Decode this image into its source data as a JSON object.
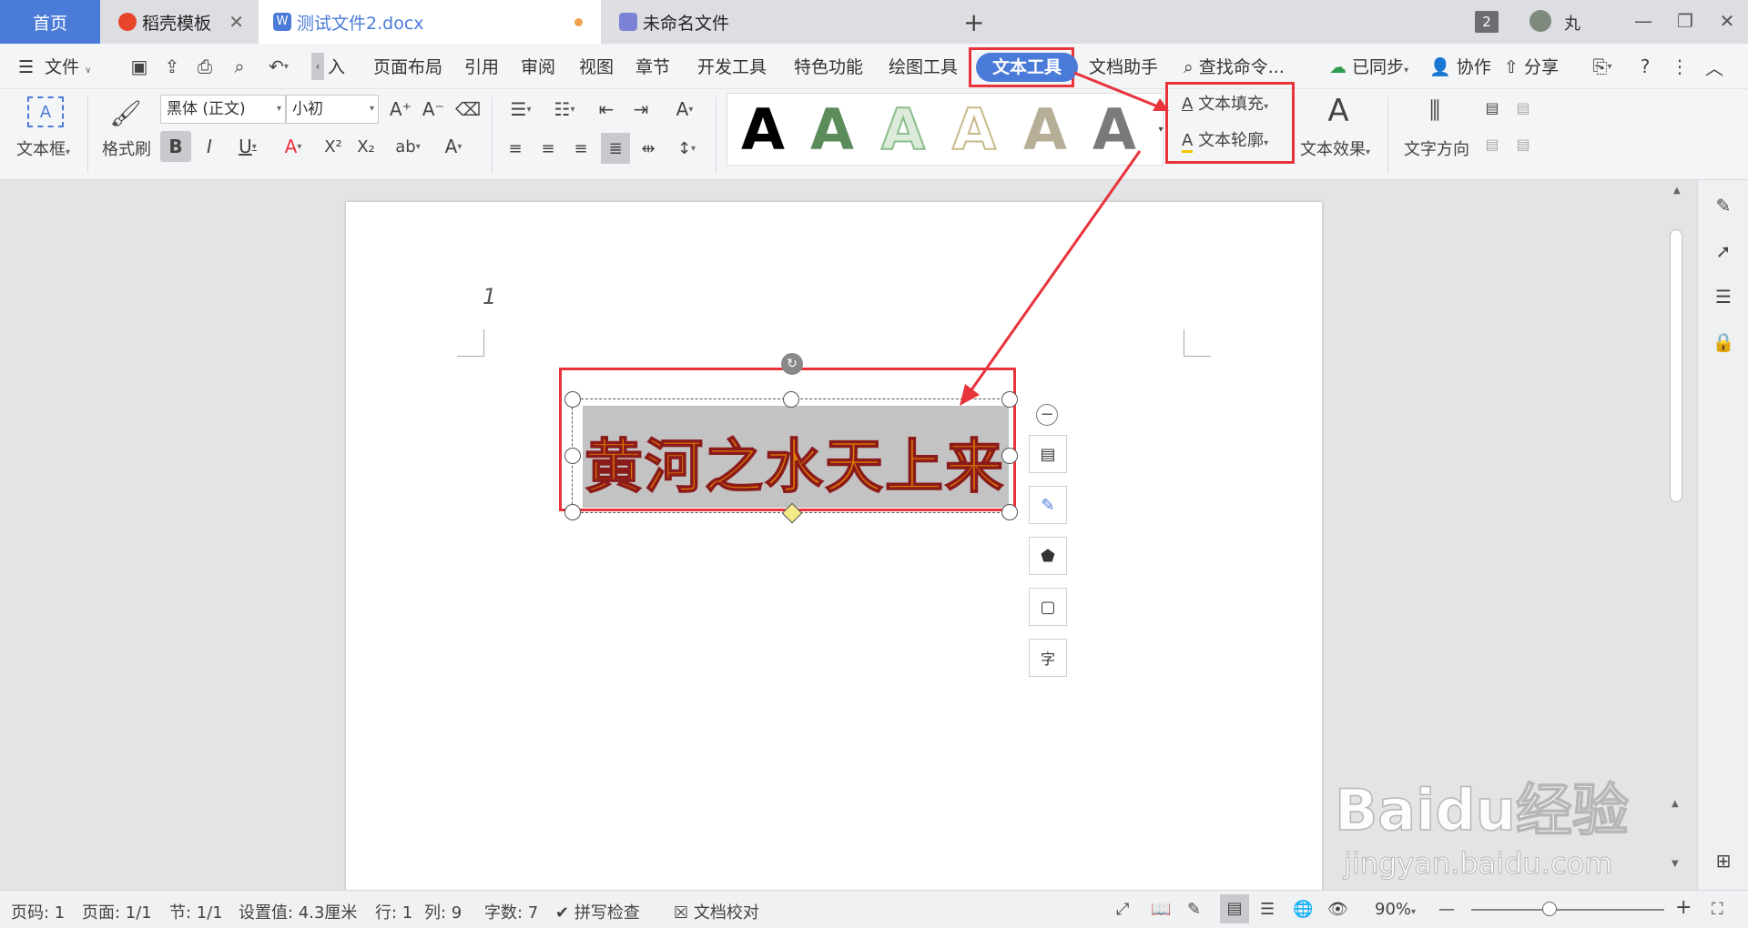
{
  "tabs": {
    "home": "首页",
    "daoke": "稻壳模板",
    "doc": "测试文件2.docx",
    "unnamed": "未命名文件",
    "new_tab": "+",
    "badge": "2",
    "user": "丸"
  },
  "menu": {
    "file": "文件",
    "insert": "入",
    "layout": "页面布局",
    "reference": "引用",
    "review": "审阅",
    "view": "视图",
    "chapter": "章节",
    "dev": "开发工具",
    "special": "特色功能",
    "drawing": "绘图工具",
    "text_tool": "文本工具",
    "doc_helper": "文档助手",
    "search": "查找命令...",
    "synced": "已同步",
    "collab": "协作",
    "share": "分享"
  },
  "toolbar": {
    "textbox": "文本框",
    "format_painter": "格式刷",
    "font_name": "黑体 (正文)",
    "font_size": "小初",
    "text_fill": "文本填充",
    "text_outline": "文本轮廓",
    "text_effect": "文本效果",
    "text_direction": "文字方向",
    "style_letter": "A"
  },
  "document": {
    "page_number_mark": "1",
    "wordart_text": "黄河之水天上来"
  },
  "status": {
    "page": "页码: 1",
    "pages": "页面: 1/1",
    "section": "节: 1/1",
    "setting": "设置值: 4.3厘米",
    "row": "行: 1",
    "col": "列: 9",
    "words": "字数: 7",
    "spell": "拼写检查",
    "proof": "文档校对",
    "zoom": "90%"
  },
  "watermark": {
    "brand": "Baidu经验",
    "url": "jingyan.baidu.com"
  },
  "colors": {
    "accent": "#4b7bd8",
    "highlight_box": "#e8333b",
    "wordart_fill": "#e07b00",
    "wordart_outline": "#8b1a1a",
    "wordart_bg": "#c3c3c3"
  }
}
